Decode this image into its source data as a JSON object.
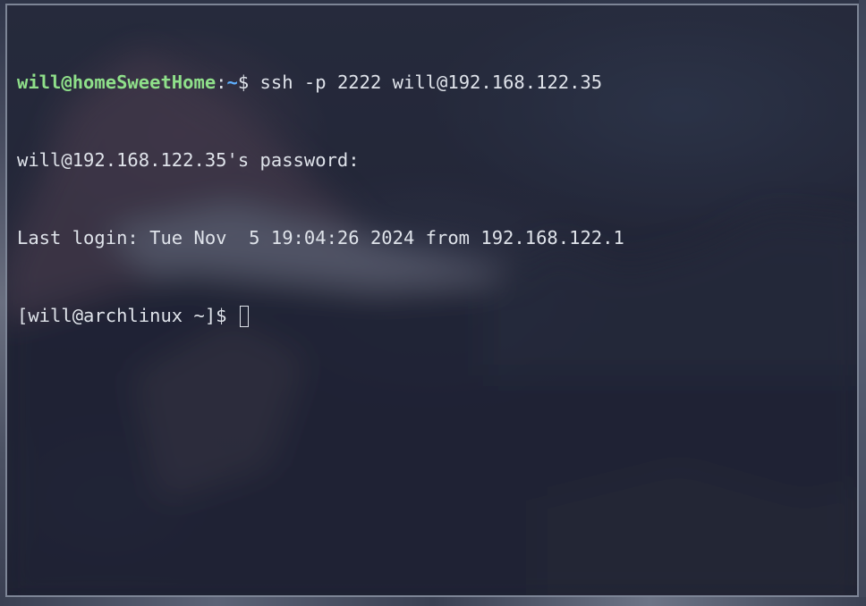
{
  "terminal": {
    "prompt_user_host": "will@homeSweetHome",
    "prompt_sep": ":",
    "prompt_path": "~",
    "prompt_symbol": "$ ",
    "command": "ssh -p 2222 will@192.168.122.35",
    "lines": [
      "will@192.168.122.35's password:",
      "Last login: Tue Nov  5 19:04:26 2024 from 192.168.122.1"
    ],
    "remote_prompt": "[will@archlinux ~]$ "
  },
  "colors": {
    "user_host": "#8fe08a",
    "path": "#5fb0ff",
    "text": "#dfe3ea",
    "border": "#7d8596"
  }
}
